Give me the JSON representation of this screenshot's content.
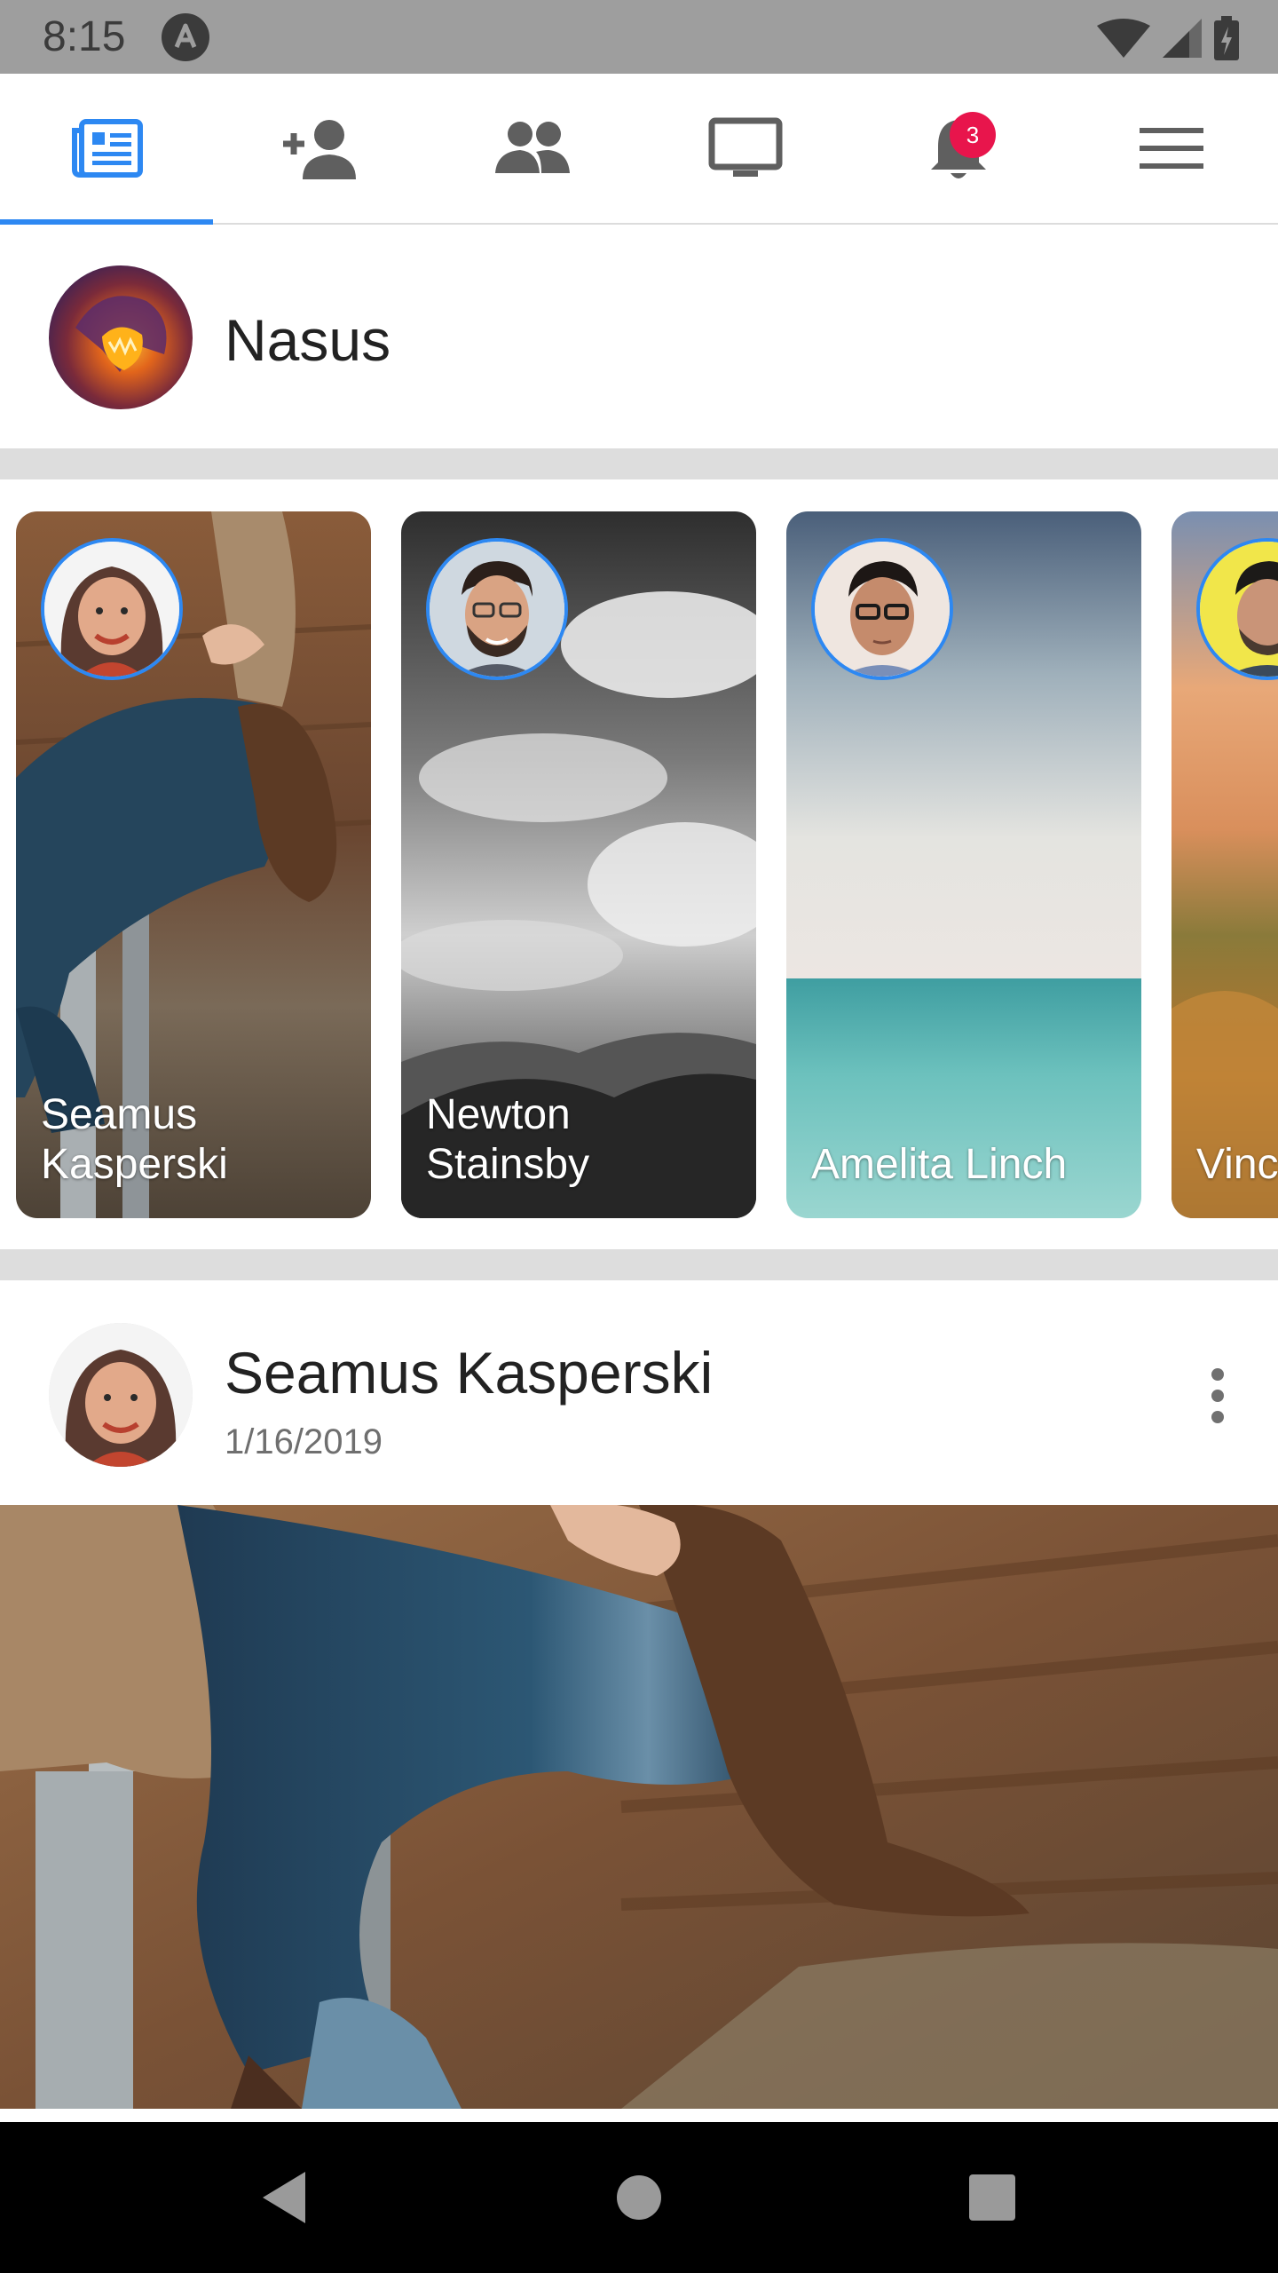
{
  "status_bar": {
    "time": "8:15",
    "colors": {
      "background": "#9e9e9e",
      "foreground": "#3b3b3b"
    },
    "icons": [
      "app-notification-icon",
      "wifi-icon",
      "signal-icon",
      "battery-icon"
    ]
  },
  "nav": {
    "tabs": [
      {
        "icon": "news-feed-icon",
        "active": true
      },
      {
        "icon": "add-friend-icon",
        "active": false
      },
      {
        "icon": "friends-icon",
        "active": false
      },
      {
        "icon": "watch-icon",
        "active": false
      },
      {
        "icon": "notifications-icon",
        "active": false
      },
      {
        "icon": "menu-icon",
        "active": false
      }
    ],
    "notification_count": "3",
    "accent_color": "#2d88f2",
    "badge_color": "#e8154c"
  },
  "composer": {
    "user_name": "Nasus"
  },
  "stories": [
    {
      "name": "Seamus Kasperski"
    },
    {
      "name": "Newton Stainsby"
    },
    {
      "name": "Amelita Linch"
    },
    {
      "name": "Vinc"
    }
  ],
  "post": {
    "author": "Seamus Kasperski",
    "date": "1/16/2019",
    "more_icon": "more-vertical-icon"
  },
  "system_nav": {
    "icons": [
      "back-icon",
      "home-icon",
      "recents-icon"
    ]
  }
}
